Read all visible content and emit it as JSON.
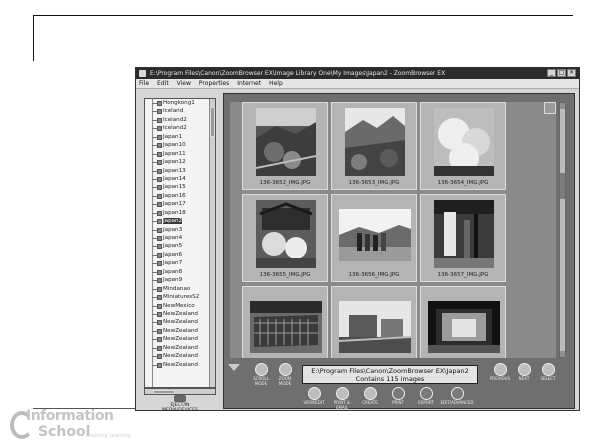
{
  "window": {
    "title": "E:\\Program Files\\Canon\\ZoomBrowser EX\\Image Library One\\My Images\\Japan2 - ZoomBrowser EX"
  },
  "menu": [
    "File",
    "Edit",
    "View",
    "Properties",
    "Internet",
    "Help"
  ],
  "tree": {
    "items": [
      "Hongkong1",
      "Iceland",
      "Iceland2",
      "Iceland2",
      "Japan1",
      "Japan10",
      "Japan11",
      "Japan12",
      "Japan13",
      "Japan14",
      "Japan15",
      "Japan16",
      "Japan17",
      "Japan18",
      "Japan2",
      "Japan3",
      "Japan4",
      "Japan5",
      "Japan6",
      "Japan7",
      "Japan8",
      "Japan9",
      "Mindanao",
      "MiniaturesS2",
      "NewMexico",
      "NewZealand",
      "NewZealand",
      "NewZealand",
      "NewZealand",
      "NewZealand",
      "NewZealand",
      "NewZealand"
    ],
    "selected_index": 14,
    "eject_label": "EJECT/IN MEDIA/DEVICES"
  },
  "thumbnails": [
    {
      "caption": "136-3652_IMG.JPG"
    },
    {
      "caption": "136-3653_IMG.JPG"
    },
    {
      "caption": "136-3654_IMG.JPG"
    },
    {
      "caption": "136-3655_IMG.JPG"
    },
    {
      "caption": "136-3656_IMG.JPG"
    },
    {
      "caption": "136-3657_IMG.JPG"
    },
    {
      "caption": ""
    },
    {
      "caption": ""
    },
    {
      "caption": ""
    }
  ],
  "controls": {
    "left_buttons": [
      "SCROLL MODE",
      "ZOOM MODE"
    ],
    "info_line1": "E:\\Program Files\\Canon\\ZoomBrowser EX\\Japan2",
    "info_line2": "Contains 115 images",
    "right_buttons": [
      "PREVIOUS",
      "NEXT",
      "SELECT"
    ],
    "bottom_buttons": [
      "VIEW/EDIT",
      "PRINT & EMAIL",
      "CREATE",
      "PRINT",
      "EXPORT",
      "EDIT/ADVANCED"
    ]
  },
  "branding": {
    "line1": "Information",
    "line2": "School",
    "tagline": "Inspiring Learning"
  }
}
